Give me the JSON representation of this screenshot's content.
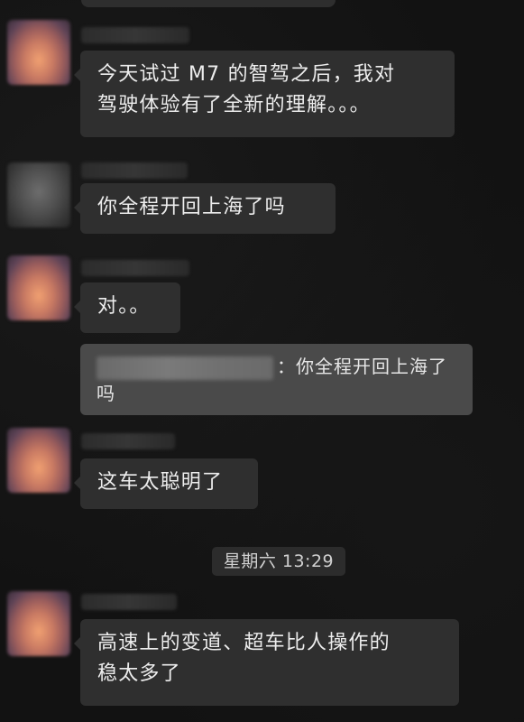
{
  "messages": [
    {
      "text_lines": [
        "今天试过 M7 的智驾之后，我对",
        "驾驶体验有了全新的理解。。。"
      ]
    },
    {
      "text_lines": [
        "你全程开回上海了吗"
      ]
    },
    {
      "text_lines": [
        "对。。"
      ]
    },
    {
      "text_lines": [
        "这车太聪明了"
      ]
    },
    {
      "text_lines": [
        "高速上的变道、超车比人操作的",
        "稳太多了"
      ]
    }
  ],
  "quote": {
    "separator": "：",
    "line1": "你全程开回上海了",
    "line2": "吗"
  },
  "timestamp": "星期六 13:29",
  "colors": {
    "background": "#121212",
    "bubble": "#2f2f2f",
    "quote": "#4a4a4a",
    "text": "#ededed"
  }
}
